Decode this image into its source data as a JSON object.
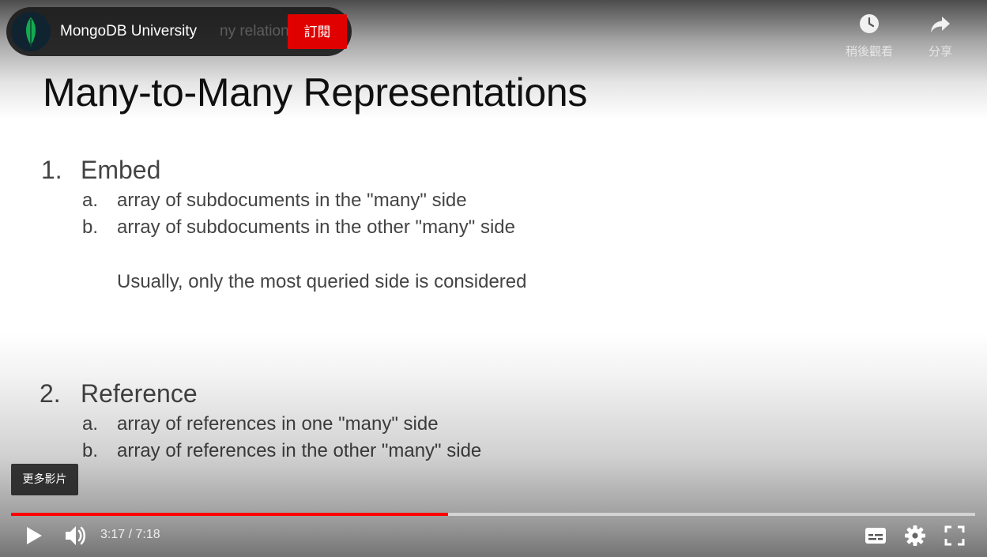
{
  "slide": {
    "title": "Many-to-Many Representations",
    "sections": [
      {
        "number": "1.",
        "title": "Embed",
        "items": [
          {
            "letter": "a.",
            "text": "array of subdocuments in the \"many\" side"
          },
          {
            "letter": "b.",
            "text": "array of subdocuments in the other \"many\" side"
          }
        ],
        "note": "Usually, only the most queried side is considered"
      },
      {
        "number": "2.",
        "title": "Reference",
        "items": [
          {
            "letter": "a.",
            "text": "array of references in one \"many\" side"
          },
          {
            "letter": "b.",
            "text": "array of references in the other \"many\" side"
          }
        ]
      }
    ]
  },
  "player": {
    "channel_name": "MongoDB University",
    "ghost_title": "ny relation",
    "subscribe_label": "訂閱",
    "watch_later_label": "稍後觀看",
    "share_label": "分享",
    "more_videos_label": "更多影片",
    "time_display": "3:17 / 7:18",
    "progress_fraction": 0.4536,
    "icons": {
      "avatar": "mongodb-leaf-icon",
      "watch_later": "clock-icon",
      "share": "share-arrow-icon",
      "play": "play-icon",
      "volume": "volume-icon",
      "captions": "captions-icon",
      "settings": "gear-icon",
      "fullscreen": "fullscreen-icon"
    },
    "colors": {
      "subscribe": "#e00000",
      "progress": "#ff0000",
      "leaf": "#13aa52"
    }
  }
}
